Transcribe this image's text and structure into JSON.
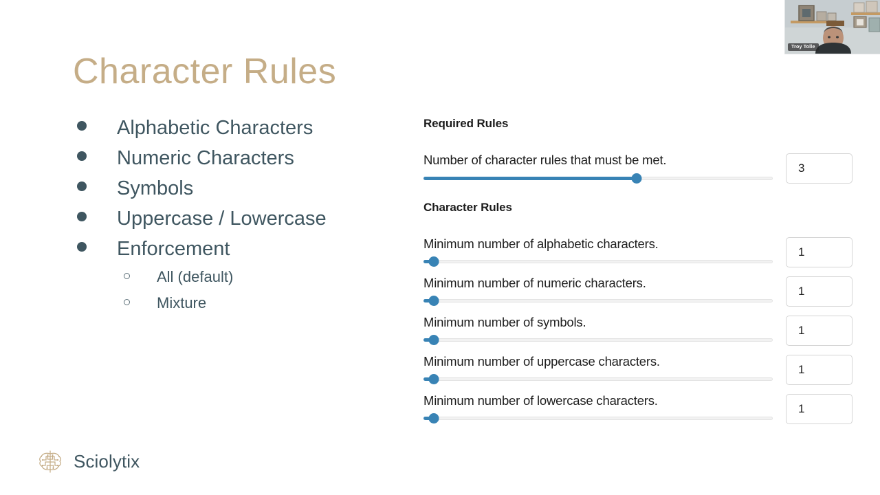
{
  "slide": {
    "title": "Character Rules",
    "background_color": "#ffffff",
    "title_color": "#c5ad87",
    "body_text_color": "#3f5660"
  },
  "bullets": [
    {
      "label": "Alphabetic Characters"
    },
    {
      "label": "Numeric Characters"
    },
    {
      "label": "Symbols"
    },
    {
      "label": "Uppercase / Lowercase"
    },
    {
      "label": "Enforcement"
    }
  ],
  "subbullets": [
    {
      "label": "All (default)"
    },
    {
      "label": "Mixture"
    }
  ],
  "settings": {
    "required_rules": {
      "heading": "Required Rules",
      "rows": [
        {
          "label": "Number of character rules that must be met.",
          "value": "3",
          "slider_percent": 61
        }
      ]
    },
    "character_rules": {
      "heading": "Character Rules",
      "rows": [
        {
          "label": "Minimum number of alphabetic characters.",
          "value": "1",
          "slider_percent": 3
        },
        {
          "label": "Minimum number of numeric characters.",
          "value": "1",
          "slider_percent": 3
        },
        {
          "label": "Minimum number of symbols.",
          "value": "1",
          "slider_percent": 3
        },
        {
          "label": "Minimum number of uppercase characters.",
          "value": "1",
          "slider_percent": 3
        },
        {
          "label": "Minimum number of lowercase characters.",
          "value": "1",
          "slider_percent": 3
        }
      ]
    },
    "slider_accent_color": "#3883b5",
    "slider_track_color": "#f2f2f2"
  },
  "footer": {
    "brand_name": "Sciolytix",
    "brand_color": "#c5ad87"
  },
  "webcam": {
    "participant_name": "Troy Tolle"
  }
}
